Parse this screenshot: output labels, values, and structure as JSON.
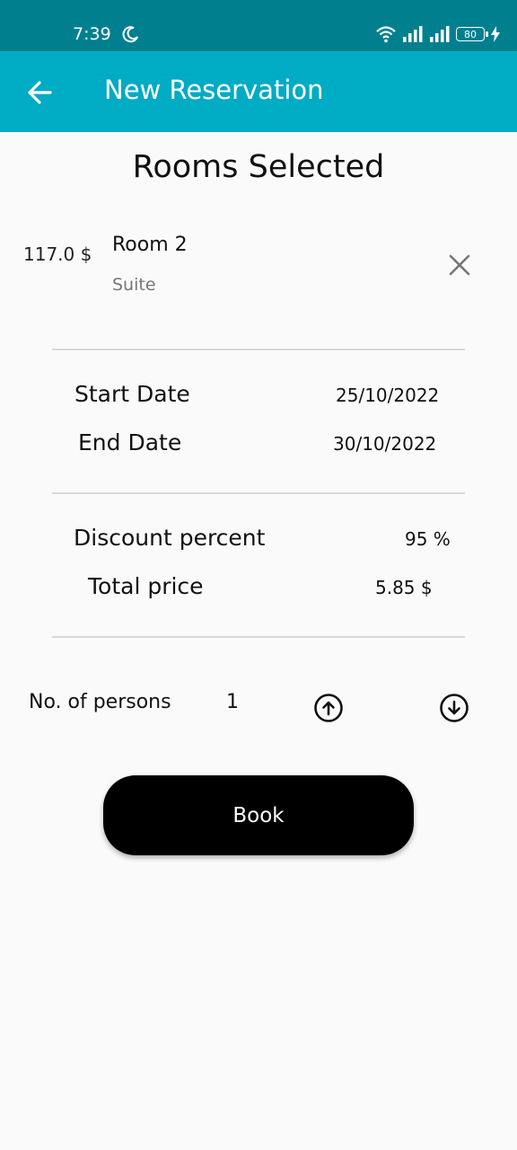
{
  "status_bar": {
    "time": "7:39",
    "battery": "80"
  },
  "app_bar": {
    "title": "New Reservation"
  },
  "section_title": "Rooms Selected",
  "room": {
    "price": "117.0 $",
    "name": "Room 2",
    "type": "Suite"
  },
  "dates": {
    "start_label": "Start Date",
    "start_value": "25/10/2022",
    "end_label": "End Date",
    "end_value": "30/10/2022"
  },
  "pricing": {
    "discount_label": "Discount percent",
    "discount_value": "95 %",
    "total_label": "Total price",
    "total_value": "5.85 $"
  },
  "persons": {
    "label": "No. of persons",
    "count": "1"
  },
  "book_button": "Book",
  "colors": {
    "status_bar": "#00808f",
    "app_bar": "#00abc4",
    "button": "#000000"
  }
}
